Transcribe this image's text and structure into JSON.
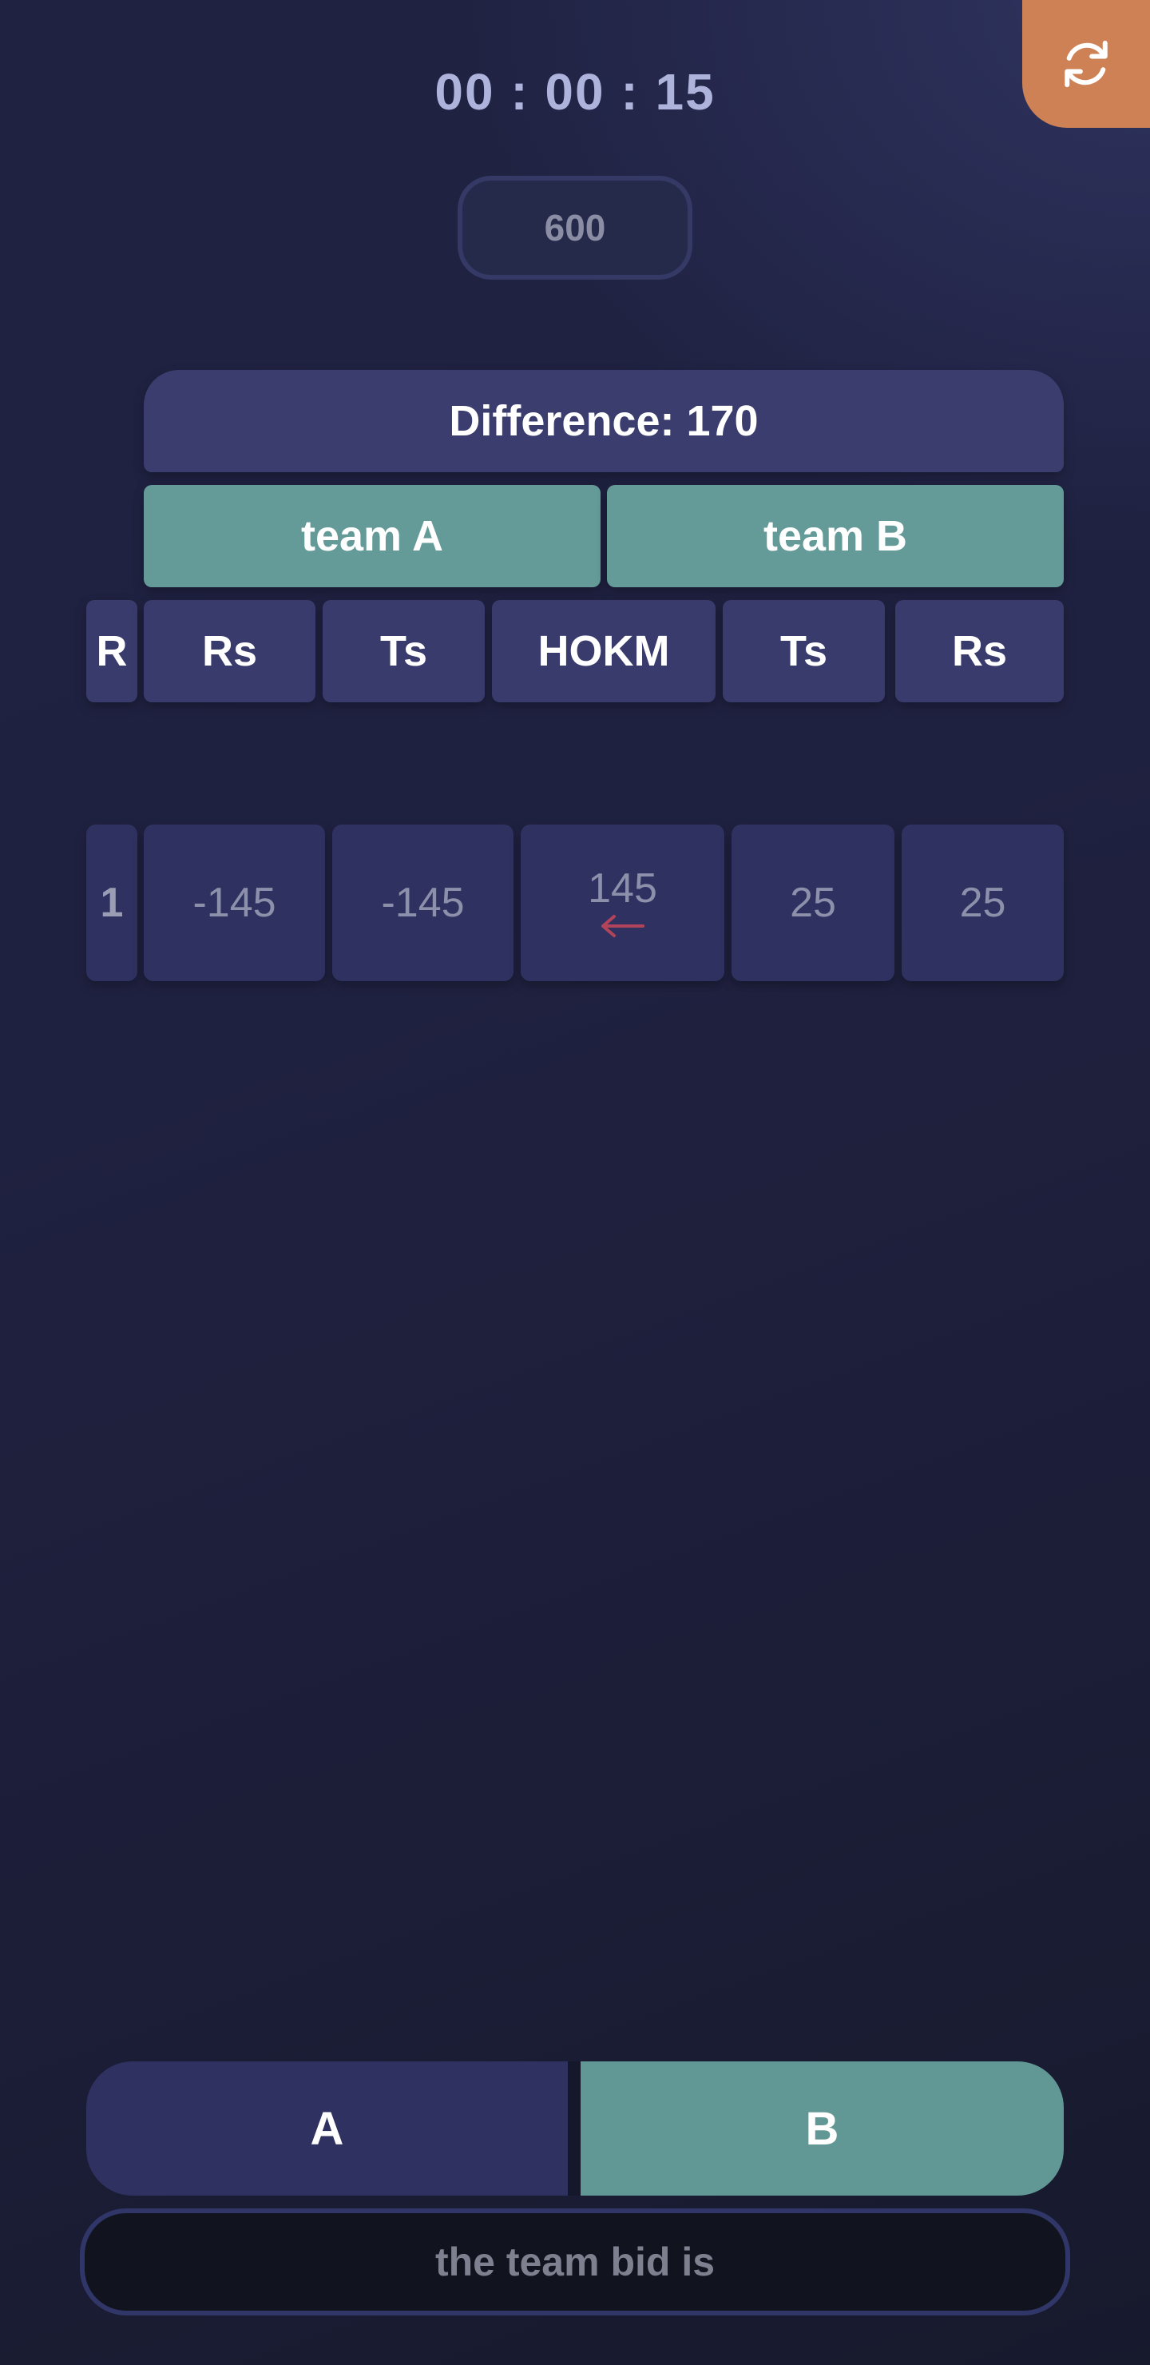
{
  "timer": "00 : 00 : 15",
  "target": "600",
  "difference_label": "Difference: 170",
  "teams": {
    "a": "team A",
    "b": "team B"
  },
  "headers": [
    "R",
    "Rs",
    "Ts",
    "HOKM",
    "Ts",
    "Rs"
  ],
  "rows": [
    {
      "round": "1",
      "a_rs": "-145",
      "a_ts": "-145",
      "hokm": "145",
      "b_ts": "25",
      "b_rs": "25",
      "hokm_direction": "left-arrow-icon"
    }
  ],
  "toggle": {
    "a": "A",
    "b": "B",
    "selected": "B"
  },
  "bid_placeholder": "the team bid is",
  "colors": {
    "accent_orange": "#cf8156",
    "team_teal": "#649b98",
    "panel": "#383b6c",
    "arrow_red": "#b1435a"
  },
  "icons": {
    "refresh": "refresh-icon",
    "arrow": "left-arrow-icon"
  }
}
